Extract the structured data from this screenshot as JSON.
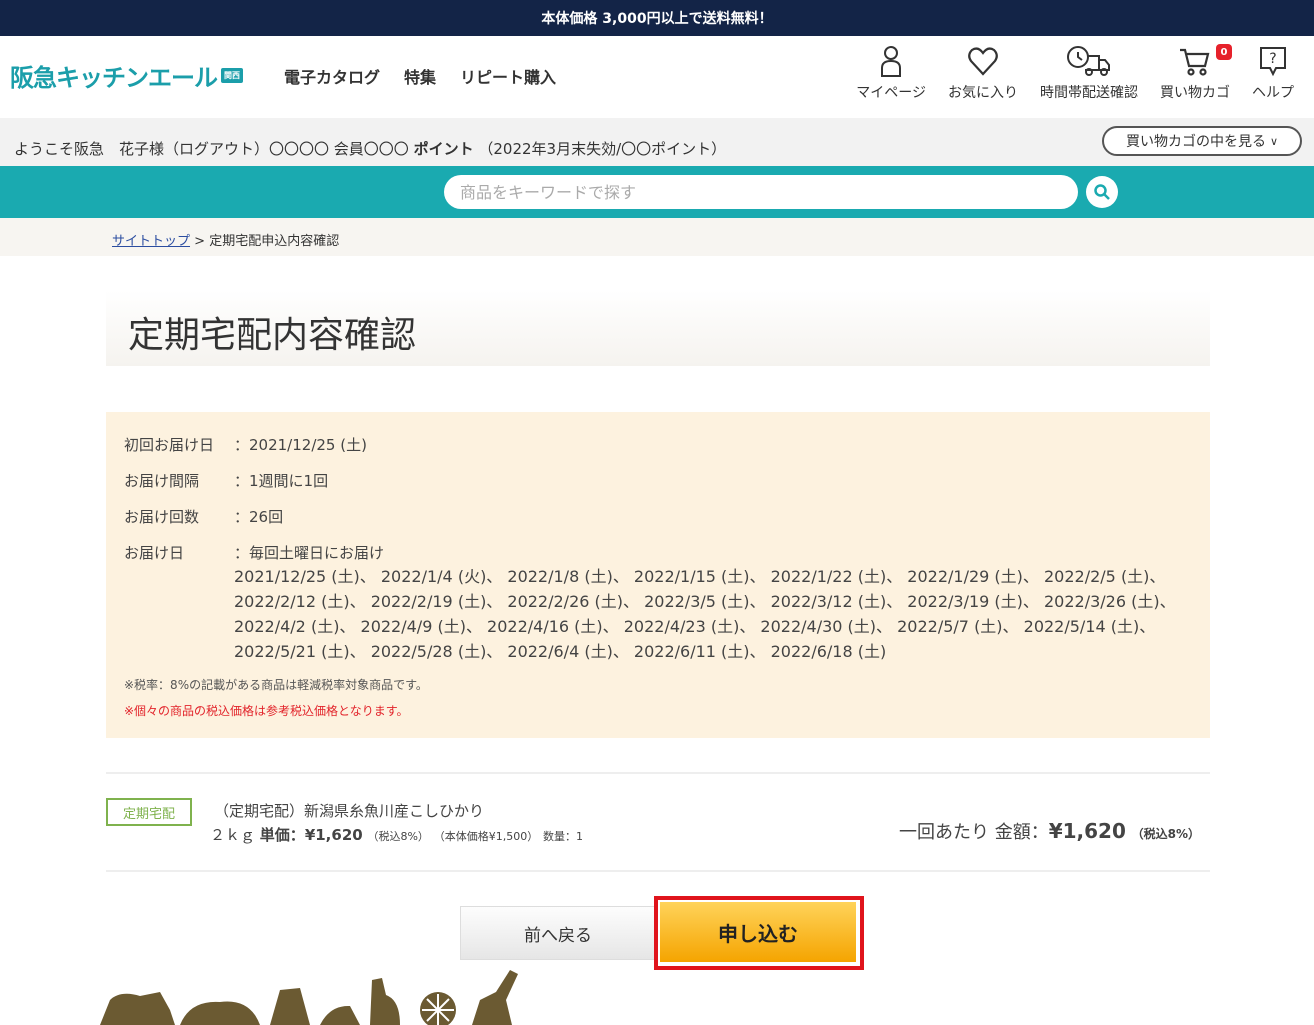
{
  "topbar": {
    "text": "本体価格 3,000円以上で送料無料！"
  },
  "header": {
    "logo": "阪急キッチンエール",
    "logo_badge": "関西",
    "nav": [
      {
        "label": "電子カタログ"
      },
      {
        "label": "特集"
      },
      {
        "label": "リピート購入"
      }
    ],
    "icons": [
      {
        "label": "マイページ",
        "icon": "person-icon"
      },
      {
        "label": "お気に入り",
        "icon": "heart-icon"
      },
      {
        "label": "時間帯配送確認",
        "icon": "truck-clock-icon"
      },
      {
        "label": "買い物カゴ",
        "icon": "cart-icon",
        "badge": "0"
      },
      {
        "label": "ヘルプ",
        "icon": "help-icon"
      }
    ]
  },
  "welcome": {
    "prefix": "ようこそ阪急　花子様（ログアウト）〇〇〇〇 会員〇〇〇",
    "points_label": "ポイント",
    "suffix": "（2022年3月末失効/〇〇ポイント）",
    "cart_view": "買い物カゴの中を見る"
  },
  "search": {
    "placeholder": "商品をキーワードで探す"
  },
  "breadcrumb": {
    "top": "サイトトップ",
    "sep": ">",
    "current": "定期宅配申込内容確認"
  },
  "page": {
    "title": "定期宅配内容確認"
  },
  "info": {
    "first_date_label": "初回お届け日",
    "first_date": "：2021/12/25 (土)",
    "interval_label": "お届け間隔",
    "interval": "：1週間に1回",
    "count_label": "お届け回数",
    "count": "：26回",
    "dates_label": "お届け日",
    "dates_intro": "：毎回土曜日にお届け",
    "dates": "2021/12/25 (土)、 2022/1/4 (火)、 2022/1/8 (土)、 2022/1/15 (土)、 2022/1/22 (土)、 2022/1/29 (土)、 2022/2/5 (土)、 2022/2/12 (土)、 2022/2/19 (土)、 2022/2/26 (土)、 2022/3/5 (土)、 2022/3/12 (土)、 2022/3/19 (土)、 2022/3/26 (土)、 2022/4/2 (土)、 2022/4/9 (土)、 2022/4/16 (土)、 2022/4/23 (土)、 2022/4/30 (土)、 2022/5/7 (土)、 2022/5/14 (土)、 2022/5/21 (土)、 2022/5/28 (土)、 2022/6/4 (土)、 2022/6/11 (土)、 2022/6/18 (土)",
    "note1": "※税率：8%の記載がある商品は軽減税率対象商品です。",
    "note2": "※個々の商品の税込価格は参考税込価格となります。"
  },
  "item": {
    "tag": "定期宅配",
    "name": "（定期宅配）新潟県糸魚川産こしひかり",
    "weight": "２ｋｇ",
    "unit_price_label": "単価：",
    "unit_price": "¥1,620",
    "unit_tax": "（税込8%）",
    "base_price": "（本体価格¥1,500）",
    "qty": "数量：1",
    "total_label": "一回あたり 金額：",
    "total": "¥1,620",
    "total_tax": "（税込8%）"
  },
  "actions": {
    "back": "前へ戻る",
    "apply": "申し込む"
  },
  "colors": {
    "navy": "#132447",
    "teal": "#1aaab0",
    "accent_red": "#e0141c",
    "apply_orange": "#f5a400"
  }
}
